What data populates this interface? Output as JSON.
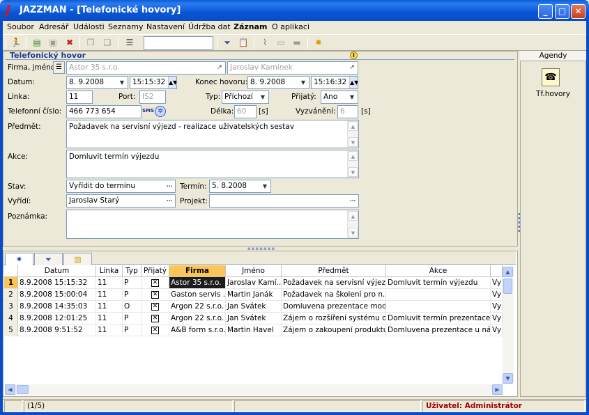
{
  "window": {
    "title": "JAZZMAN - [Telefonické hovory]",
    "logo": "J"
  },
  "menu": [
    "Soubor",
    "Adresář",
    "Události",
    "Seznamy",
    "Nastavení",
    "Údržba dat",
    "Záznam",
    "O aplikaci"
  ],
  "toolbar": {
    "search_value": ""
  },
  "form": {
    "section_title": "Telefonický hovor",
    "labels": {
      "firma": "Firma, jméno:",
      "datum": "Datum:",
      "konec": "Konec hovoru:",
      "linka": "Linka:",
      "port": "Port:",
      "typ": "Typ:",
      "prijaty": "Přijatý:",
      "telefon": "Telefonní číslo:",
      "delka": "Délka:",
      "vyzvaneni": "Vyzvánění:",
      "predmet": "Předmět:",
      "akce": "Akce:",
      "stav": "Stav:",
      "termin": "Termín:",
      "vyridi": "Vyřídí:",
      "projekt": "Projekt:",
      "poznamka": "Poznámka:",
      "sec1": "[s]",
      "sec2": "[s]"
    },
    "firma": "Astor 35 s.r.o.",
    "jmeno": "Jaroslav Kamínek",
    "datum": "8. 9.2008",
    "cas": "15:15:32",
    "konec_datum": "8. 9.2008",
    "konec_cas": "15:16:32",
    "linka": "11",
    "port": "IS2",
    "typ": "Příchozí",
    "prijaty": "Ano",
    "telefon": "466 773 654",
    "sms": "SMS",
    "delka": "60",
    "vyzvaneni": "6",
    "predmet": "Požadavek na servisní výjezd - realizace uživatelských sestav",
    "akce": "Domluvit termín výjezdu",
    "stav": "Vyřídit do termínu",
    "termin": "5. 8.2008",
    "vyridi": "Jaroslav Starý",
    "projekt": "",
    "poznamka": ""
  },
  "grid": {
    "tabs": [
      "✷",
      "filter-icon",
      "notes-icon"
    ],
    "columns": [
      "Datum",
      "Linka",
      "Typ",
      "Přijatý",
      "Firma",
      "Jméno",
      "Předmět",
      "Akce"
    ],
    "sorted_column": "Firma",
    "rows": [
      {
        "n": "1",
        "datum": "8.9.2008 15:15:32",
        "linka": "11",
        "typ": "P",
        "prijaty": "✕",
        "firma": "Astor 35 s.r.o.",
        "jmeno": "Jaroslav Kamí...",
        "predmet": "Požadavek na servisní výjez...",
        "akce": "Domluvit termín výjezdu",
        "extra": "Vyř"
      },
      {
        "n": "2",
        "datum": "8.9.2008 15:00:04",
        "linka": "11",
        "typ": "P",
        "prijaty": "✕",
        "firma": "Gaston servis ...",
        "jmeno": "Martin Janák",
        "predmet": "Požadavek na školení pro n...",
        "akce": "",
        "extra": "Vyř"
      },
      {
        "n": "3",
        "datum": "8.9.2008 14:35:03",
        "linka": "11",
        "typ": "O",
        "prijaty": "✕",
        "firma": "Argon 22 s.r.o.",
        "jmeno": "Jan Svátek",
        "predmet": "Domluvena prezentace mod...",
        "akce": "",
        "extra": "Vyř"
      },
      {
        "n": "4",
        "datum": "8.9.2008 12:01:25",
        "linka": "11",
        "typ": "P",
        "prijaty": "✕",
        "firma": "Argon 22 s.r.o.",
        "jmeno": "Jan Svátek",
        "predmet": "Zájem o rozšíření systému o ...",
        "akce": "Domluvit termín prezentace",
        "extra": "Vyř"
      },
      {
        "n": "5",
        "datum": "8.9.2008 9:51:52",
        "linka": "11",
        "typ": "P",
        "prijaty": "✕",
        "firma": "A&B form s.r.o.",
        "jmeno": "Martin Havel",
        "predmet": "Zájem o zakoupení produktu...",
        "akce": "Domluvena prezentace u ná...",
        "extra": "Vyř"
      }
    ]
  },
  "status": {
    "count": "(1/5)",
    "user": "Uživatel: Administrátor"
  },
  "agendy": {
    "title": "Agendy",
    "item": "Tf.hovory"
  }
}
